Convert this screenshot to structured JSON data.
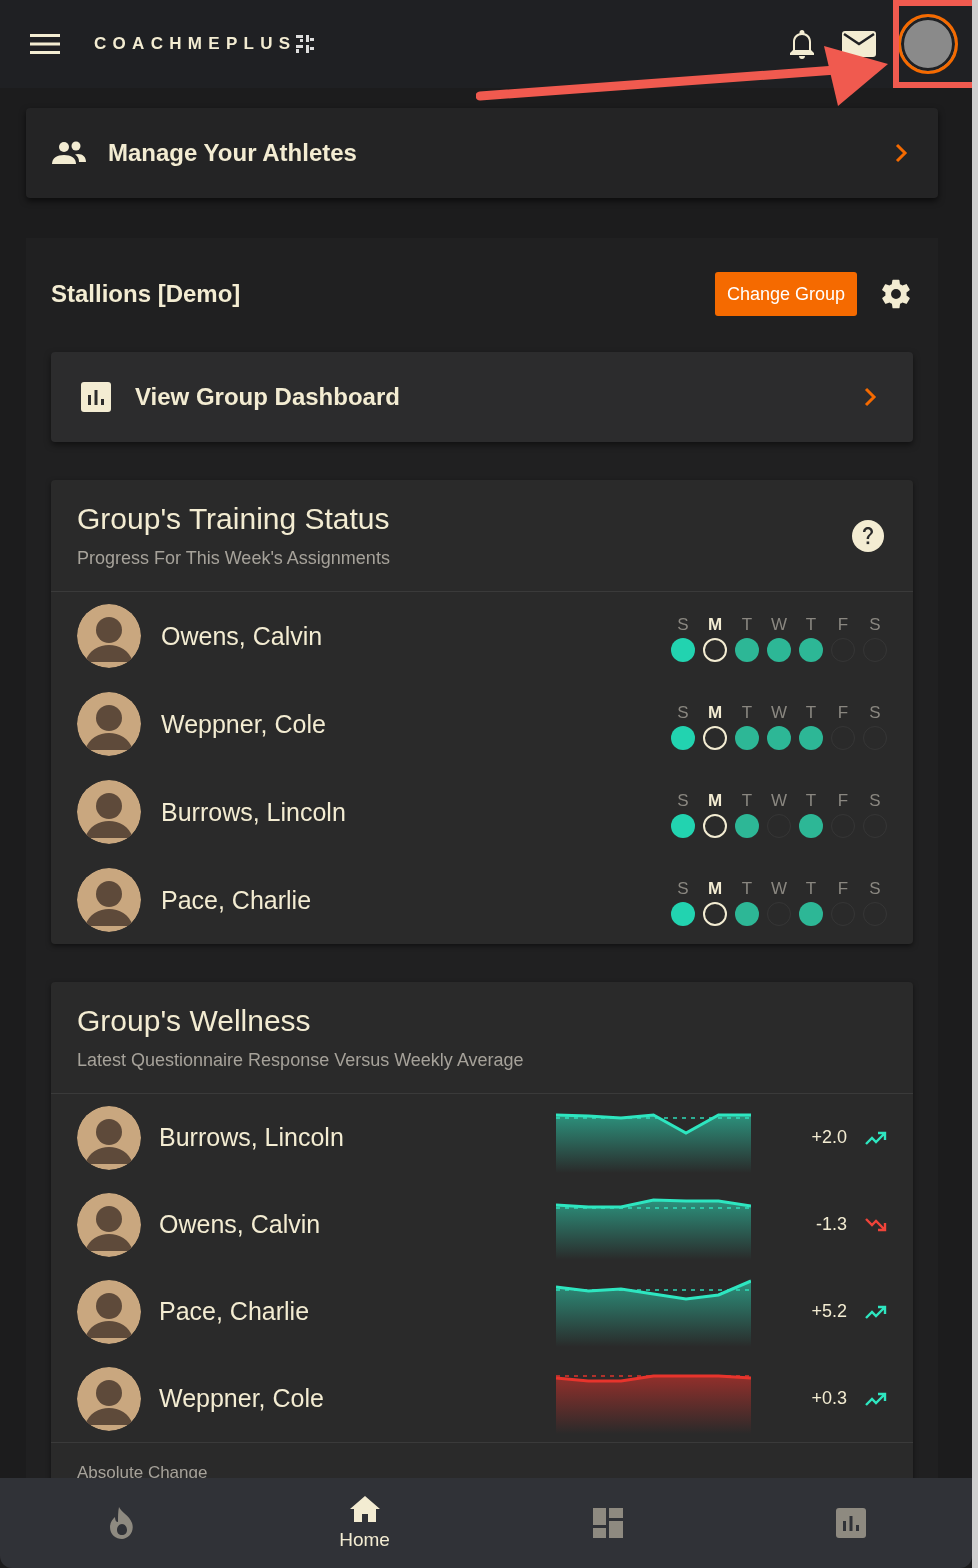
{
  "header": {
    "logo": "COACHMEPLUS"
  },
  "annotation": {
    "kind": "arrow_with_box"
  },
  "manage_link": {
    "label": "Manage Your Athletes"
  },
  "group": {
    "name": "Stallions [Demo]",
    "change_button": "Change Group"
  },
  "dashboard_link": {
    "label": "View Group Dashboard"
  },
  "training_status": {
    "title": "Group's Training Status",
    "subtitle": "Progress For This Week's Assignments",
    "athletes": [
      {
        "name": "Owens, Calvin",
        "days": [
          {
            "label": "S",
            "today": false,
            "color": "#22d3b0"
          },
          {
            "label": "M",
            "today": true
          },
          {
            "label": "T",
            "today": false,
            "color": "#2db796"
          },
          {
            "label": "W",
            "today": false,
            "color": "#2db796"
          },
          {
            "label": "T",
            "today": false,
            "color": "#2db796"
          },
          {
            "label": "F",
            "today": false
          },
          {
            "label": "S",
            "today": false
          }
        ]
      },
      {
        "name": "Weppner, Cole",
        "days": [
          {
            "label": "S",
            "today": false,
            "color": "#22d3b0"
          },
          {
            "label": "M",
            "today": true
          },
          {
            "label": "T",
            "today": false,
            "color": "#2db796"
          },
          {
            "label": "W",
            "today": false,
            "color": "#2db796"
          },
          {
            "label": "T",
            "today": false,
            "color": "#2db796"
          },
          {
            "label": "F",
            "today": false
          },
          {
            "label": "S",
            "today": false
          }
        ]
      },
      {
        "name": "Burrows, Lincoln",
        "days": [
          {
            "label": "S",
            "today": false,
            "color": "#22d3b0"
          },
          {
            "label": "M",
            "today": true
          },
          {
            "label": "T",
            "today": false,
            "color": "#2db796"
          },
          {
            "label": "W",
            "today": false
          },
          {
            "label": "T",
            "today": false,
            "color": "#2db796"
          },
          {
            "label": "F",
            "today": false
          },
          {
            "label": "S",
            "today": false
          }
        ]
      },
      {
        "name": "Pace, Charlie",
        "days": [
          {
            "label": "S",
            "today": false,
            "color": "#22d3b0"
          },
          {
            "label": "M",
            "today": true
          },
          {
            "label": "T",
            "today": false,
            "color": "#2db796"
          },
          {
            "label": "W",
            "today": false
          },
          {
            "label": "T",
            "today": false,
            "color": "#2db796"
          },
          {
            "label": "F",
            "today": false
          },
          {
            "label": "S",
            "today": false
          }
        ]
      }
    ]
  },
  "wellness": {
    "title": "Group's Wellness",
    "subtitle": "Latest Questionnaire Response Versus Weekly Average",
    "athletes": [
      {
        "name": "Burrows, Lincoln",
        "color": "#2ee6c0",
        "change": "+2.0",
        "kind": "rising"
      },
      {
        "name": "Owens, Calvin",
        "color": "#2ee6c0",
        "change": "-1.3",
        "kind": "falling"
      },
      {
        "name": "Pace, Charlie",
        "color": "#2ee6c0",
        "change": "+5.2",
        "kind": "rising"
      },
      {
        "name": "Weppner, Cole",
        "color": "#e8342c",
        "change": "+0.3",
        "kind": "rising"
      }
    ],
    "footer": "Absolute Change"
  },
  "bottom_nav": [
    {
      "kind": "flame",
      "selected": false
    },
    {
      "kind": "home",
      "label": "Home",
      "selected": true
    },
    {
      "kind": "dashboard",
      "selected": false
    },
    {
      "kind": "chart",
      "selected": false
    }
  ]
}
